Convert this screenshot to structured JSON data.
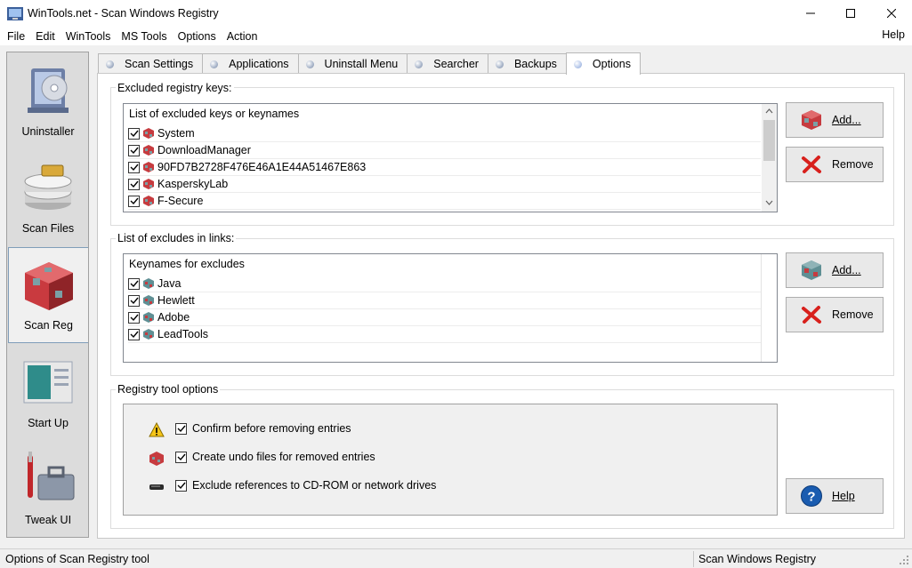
{
  "window": {
    "title": "WinTools.net - Scan Windows Registry"
  },
  "menu": {
    "items": [
      "File",
      "Edit",
      "WinTools",
      "MS Tools",
      "Options",
      "Action"
    ],
    "help": "Help"
  },
  "sidebar": {
    "items": [
      {
        "label": "Uninstaller",
        "icon": "uninstaller-icon"
      },
      {
        "label": "Scan Files",
        "icon": "scan-files-icon"
      },
      {
        "label": "Scan Reg",
        "icon": "scan-reg-icon",
        "active": true
      },
      {
        "label": "Start Up",
        "icon": "startup-icon"
      },
      {
        "label": "Tweak UI",
        "icon": "tweak-ui-icon"
      }
    ]
  },
  "tabs": [
    {
      "label": "Scan Settings"
    },
    {
      "label": "Applications"
    },
    {
      "label": "Uninstall Menu"
    },
    {
      "label": "Searcher"
    },
    {
      "label": "Backups"
    },
    {
      "label": "Options",
      "active": true
    }
  ],
  "excluded_keys": {
    "group_title": "Excluded registry keys:",
    "list_header": "List of excluded keys or keynames",
    "rows": [
      {
        "checked": true,
        "name": "System"
      },
      {
        "checked": true,
        "name": "DownloadManager"
      },
      {
        "checked": true,
        "name": "90FD7B2728F476E46A1E44A51467E863"
      },
      {
        "checked": true,
        "name": "KasperskyLab"
      },
      {
        "checked": true,
        "name": "F-Secure"
      }
    ],
    "add_label": "Add...",
    "remove_label": "Remove"
  },
  "excluded_links": {
    "group_title": "List of excludes in links:",
    "list_header": "Keynames for excludes",
    "rows": [
      {
        "checked": true,
        "name": "Java"
      },
      {
        "checked": true,
        "name": "Hewlett"
      },
      {
        "checked": true,
        "name": "Adobe"
      },
      {
        "checked": true,
        "name": "LeadTools"
      }
    ],
    "add_label": "Add...",
    "remove_label": "Remove"
  },
  "tool_options": {
    "group_title": "Registry tool options",
    "options": [
      {
        "checked": true,
        "label": "Confirm before removing entries",
        "icon": "warning-icon"
      },
      {
        "checked": true,
        "label": "Create undo files for removed entries",
        "icon": "registry-cube-icon"
      },
      {
        "checked": true,
        "label": "Exclude references to CD-ROM or network drives",
        "icon": "drive-icon"
      }
    ],
    "help_label": "Help"
  },
  "status": {
    "left": "Options of Scan Registry tool",
    "right": "Scan Windows Registry"
  },
  "colors": {
    "accent": "#1a5cb0",
    "remove_red": "#d8201c"
  }
}
